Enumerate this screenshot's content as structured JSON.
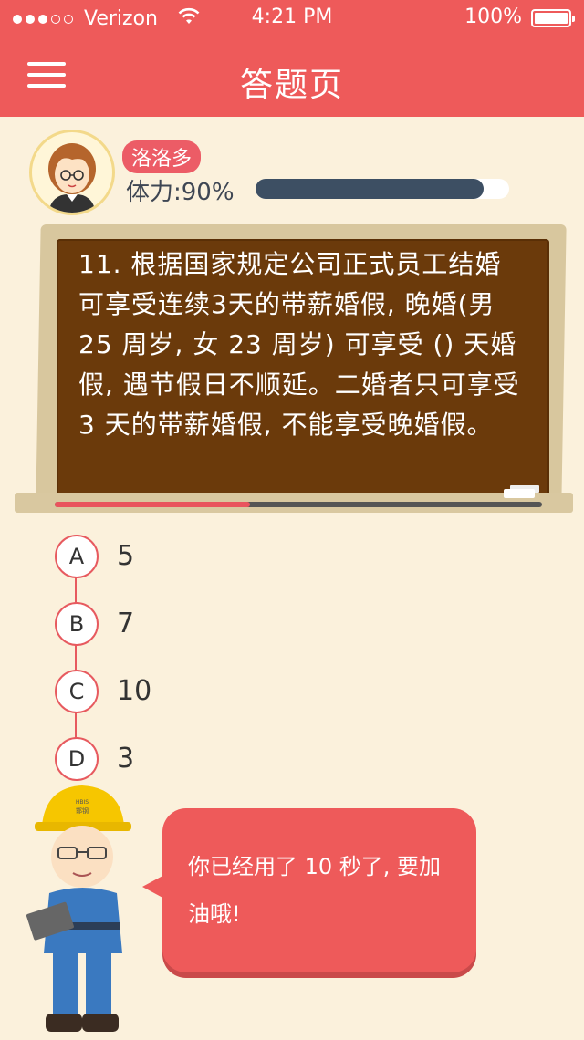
{
  "status_bar": {
    "carrier": "Verizon",
    "signal_bars_filled": 3,
    "signal_bars_total": 5,
    "time": "4:21 PM",
    "battery_percent": "100%",
    "wifi_icon": "wifi-icon"
  },
  "header": {
    "title": "答题页",
    "menu_icon": "hamburger-menu-icon"
  },
  "profile": {
    "name": "洛洛多",
    "stamina_label": "体力:90%",
    "stamina_fraction": 0.9
  },
  "question": {
    "text": "11. 根据国家规定公司正式员工结婚可享受连续3天的带薪婚假, 晚婚(男 25 周岁, 女 23 周岁) 可享受 () 天婚假, 遇节假日不顺延。二婚者只可享受 3 天的带薪婚假, 不能享受晚婚假。",
    "progress_fraction": 0.4
  },
  "options": [
    {
      "letter": "A",
      "value": "5"
    },
    {
      "letter": "B",
      "value": "7"
    },
    {
      "letter": "C",
      "value": "10"
    },
    {
      "letter": "D",
      "value": "3"
    }
  ],
  "helper": {
    "message": "你已经用了 10 秒了, 要加油哦!",
    "helmet_text": "HBIS 邯钢"
  },
  "colors": {
    "brand_red": "#ee5a5a",
    "background": "#fbf1dc",
    "chalkboard": "#6b3a0b",
    "stamina_fill": "#3d4f63"
  }
}
